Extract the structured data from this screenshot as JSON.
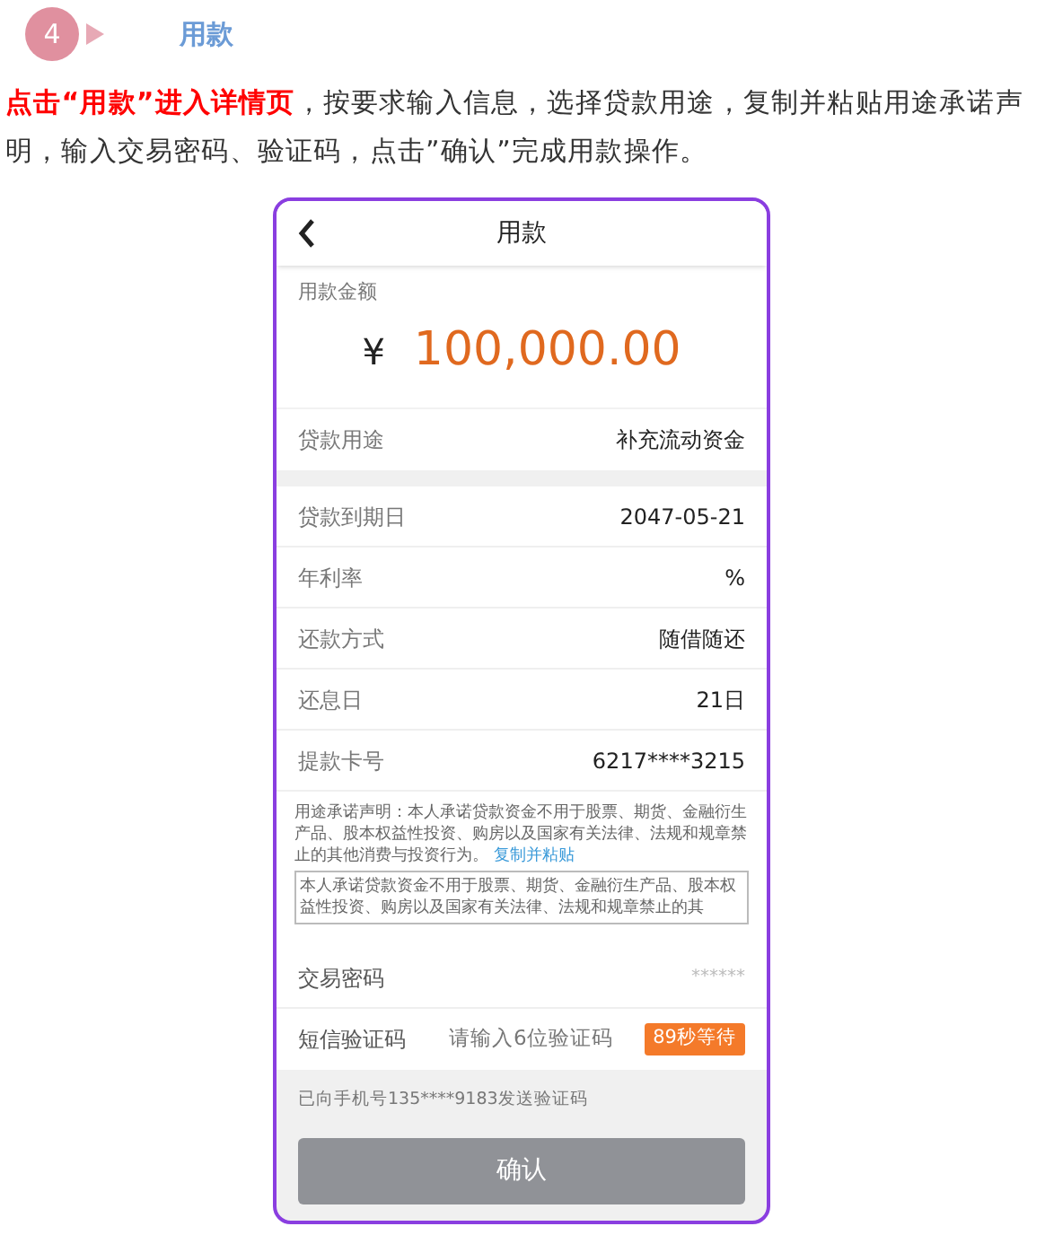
{
  "step": {
    "number": "4",
    "title": "用款"
  },
  "instruction": "**点击“用款”进入详情页**，按要求输入信息，选择贷款用途，复制并粘贴用途承诺声明，输入交易密码、验证码，点击”确认”完成用款操作。",
  "phone": {
    "title_bar": {
      "title": "用款"
    },
    "amount": {
      "label": "用款金额",
      "currency": "¥",
      "value": "100,000.00"
    },
    "purpose": {
      "label": "贷款用途",
      "value": "补充流动资金"
    },
    "details": [
      {
        "label": "贷款到期日",
        "value": "2047-05-21"
      },
      {
        "label": "年利率",
        "value": "%"
      },
      {
        "label": "还款方式",
        "value": "随借随还"
      },
      {
        "label": "还息日",
        "value": "21日"
      },
      {
        "label": "提款卡号",
        "value": "6217****3215"
      }
    ],
    "statement": {
      "text": "用途承诺声明：本人承诺贷款资金不用于股票、期货、金融衍生产品、股本权益性投资、购房以及国家有关法律、法规和规章禁止的其他消费与投资行为。",
      "link": "复制并粘贴",
      "textarea_value": "本人承诺贷款资金不用于股票、期货、金融衍生产品、股本权益性投资、购房以及国家有关法律、法规和规章禁止的其"
    },
    "password": {
      "label": "交易密码",
      "placeholder": "******"
    },
    "sms": {
      "label": "短信验证码",
      "placeholder": "请输入6位验证码",
      "countdown": "89秒等待"
    },
    "sent_note": "已向手机号135****9183发送验证码",
    "confirm": {
      "label": "确认",
      "disabled": true
    }
  }
}
